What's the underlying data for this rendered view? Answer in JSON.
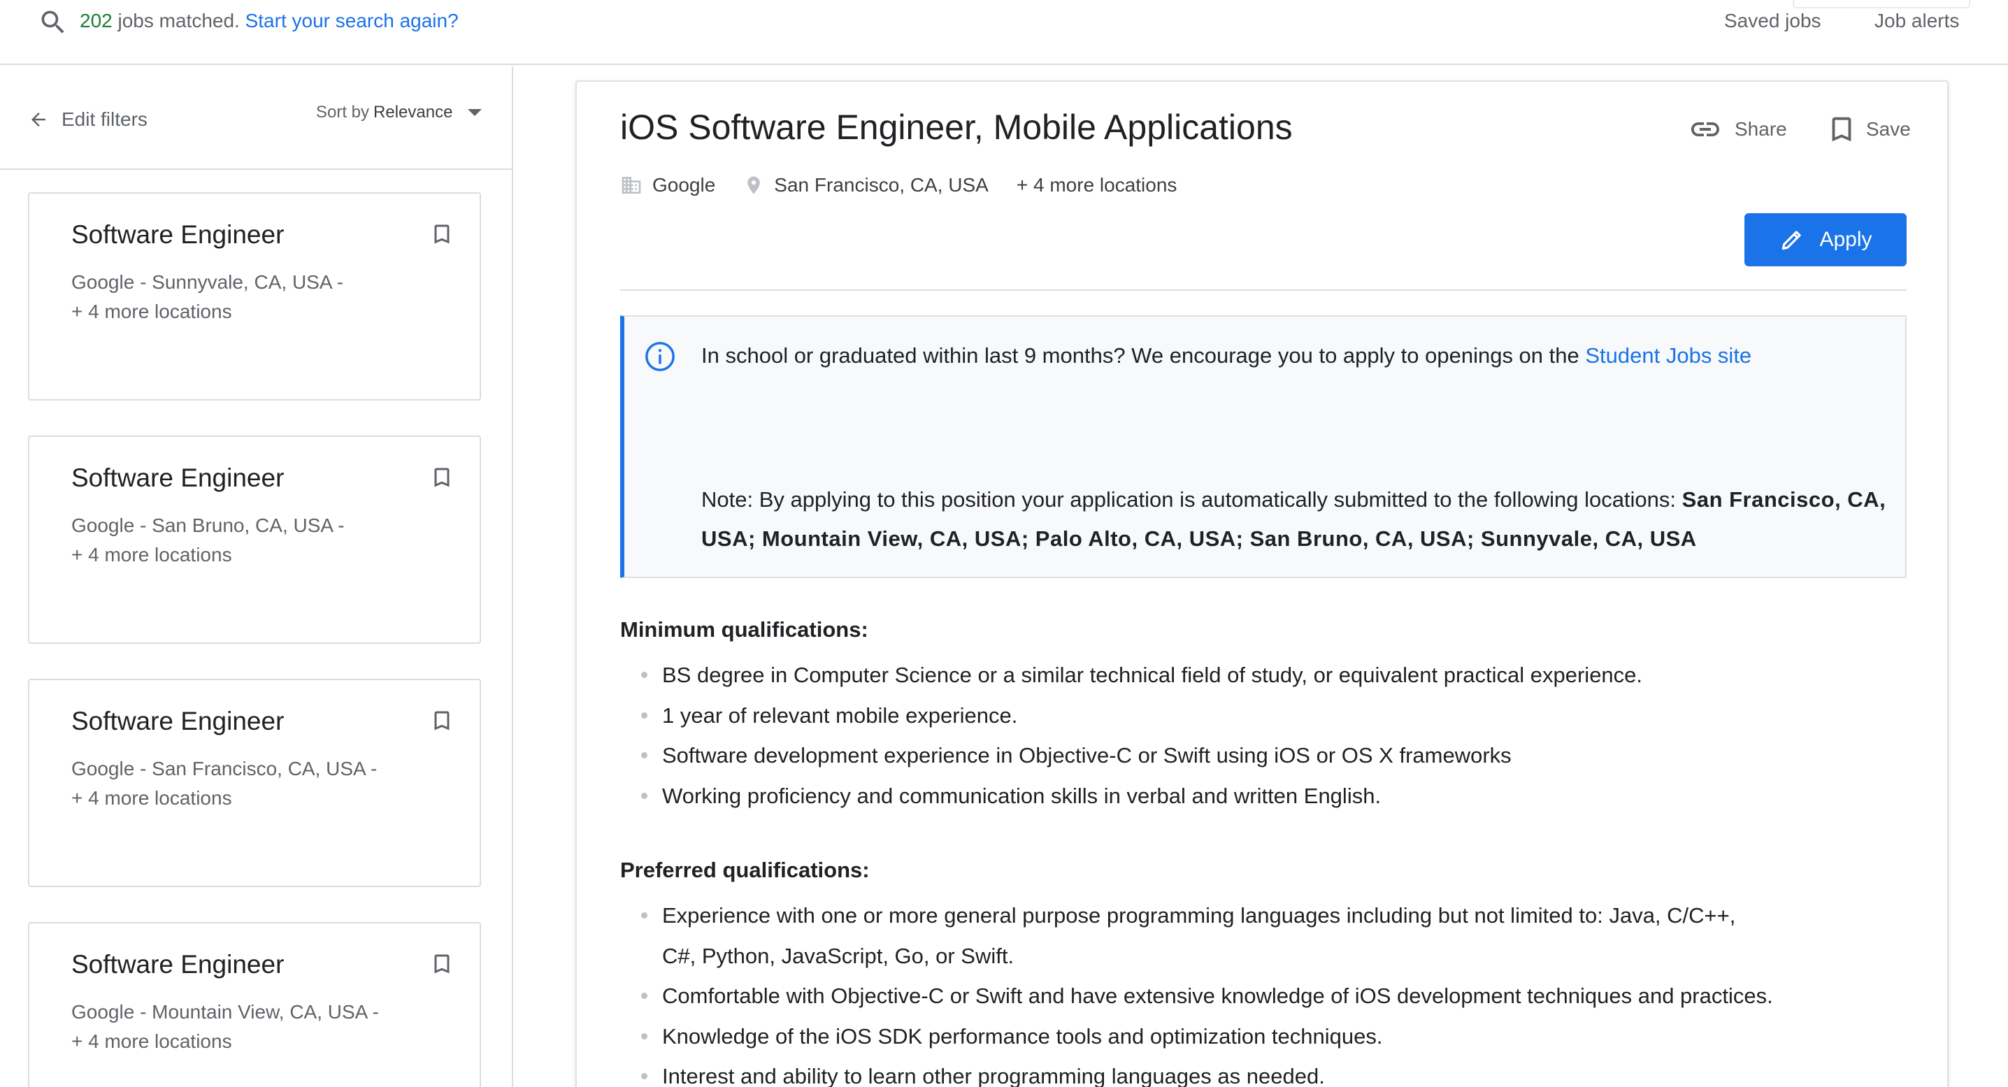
{
  "topbar": {
    "count": "202",
    "matched_text": " jobs matched. ",
    "search_again": "Start your search again?",
    "saved_jobs": "Saved jobs",
    "job_alerts": "Job alerts"
  },
  "filters": {
    "edit_filters": "Edit filters",
    "sort_by_label": "Sort by",
    "sort_by_value": "Relevance"
  },
  "results": [
    {
      "title": "Software Engineer",
      "location": "Google - Sunnyvale, CA, USA -",
      "more": "+ 4 more locations"
    },
    {
      "title": "Software Engineer",
      "location": "Google - San Bruno, CA, USA -",
      "more": "+ 4 more locations"
    },
    {
      "title": "Software Engineer",
      "location": "Google - San Francisco, CA, USA -",
      "more": "+ 4 more locations"
    },
    {
      "title": "Software Engineer",
      "location": "Google - Mountain View, CA, USA -",
      "more": "+ 4 more locations"
    }
  ],
  "job": {
    "title": "iOS Software Engineer, Mobile Applications",
    "company": "Google",
    "location": "San Francisco, CA, USA",
    "more_locations": "+ 4 more locations",
    "share_label": "Share",
    "save_label": "Save",
    "apply_label": "Apply",
    "notice": {
      "line1": "In school or graduated within last 9 months? We encourage you to apply to openings on the ",
      "link": "Student Jobs site",
      "note_prefix": "Note: By applying to this position your application is automatically submitted to the following locations: ",
      "note_locations": "San Francisco, CA, USA; Mountain View, CA, USA; Palo Alto, CA, USA; San Bruno, CA, USA; Sunnyvale, CA, USA"
    },
    "min_heading": "Minimum qualifications:",
    "min_qualifications": [
      "BS degree in Computer Science or a similar technical field of study, or equivalent practical experience.",
      "1 year of relevant mobile experience.",
      "Software development experience in Objective-C or Swift using iOS or OS X frameworks",
      "Working proficiency and communication skills in verbal and written English."
    ],
    "pref_heading": "Preferred qualifications:",
    "preferred_qualifications": [
      "Experience with one or more general purpose programming languages including but not limited to: Java, C/C++, C#, Python, JavaScript, Go, or Swift.",
      "Comfortable with Objective-C or Swift and have extensive knowledge of iOS development techniques and practices.",
      "Knowledge of the iOS SDK performance tools and optimization techniques.",
      "Interest and ability to learn other programming languages as needed."
    ]
  },
  "colors": {
    "accent": "#1a73e8",
    "count_green": "#188038",
    "border": "#dadce0",
    "notice_bg": "#f8f9fa"
  },
  "icons": [
    "search-icon",
    "arrow-left-icon",
    "caret-down-icon",
    "bookmark-icon",
    "building-icon",
    "location-pin-icon",
    "link-icon",
    "pencil-icon",
    "info-icon"
  ]
}
